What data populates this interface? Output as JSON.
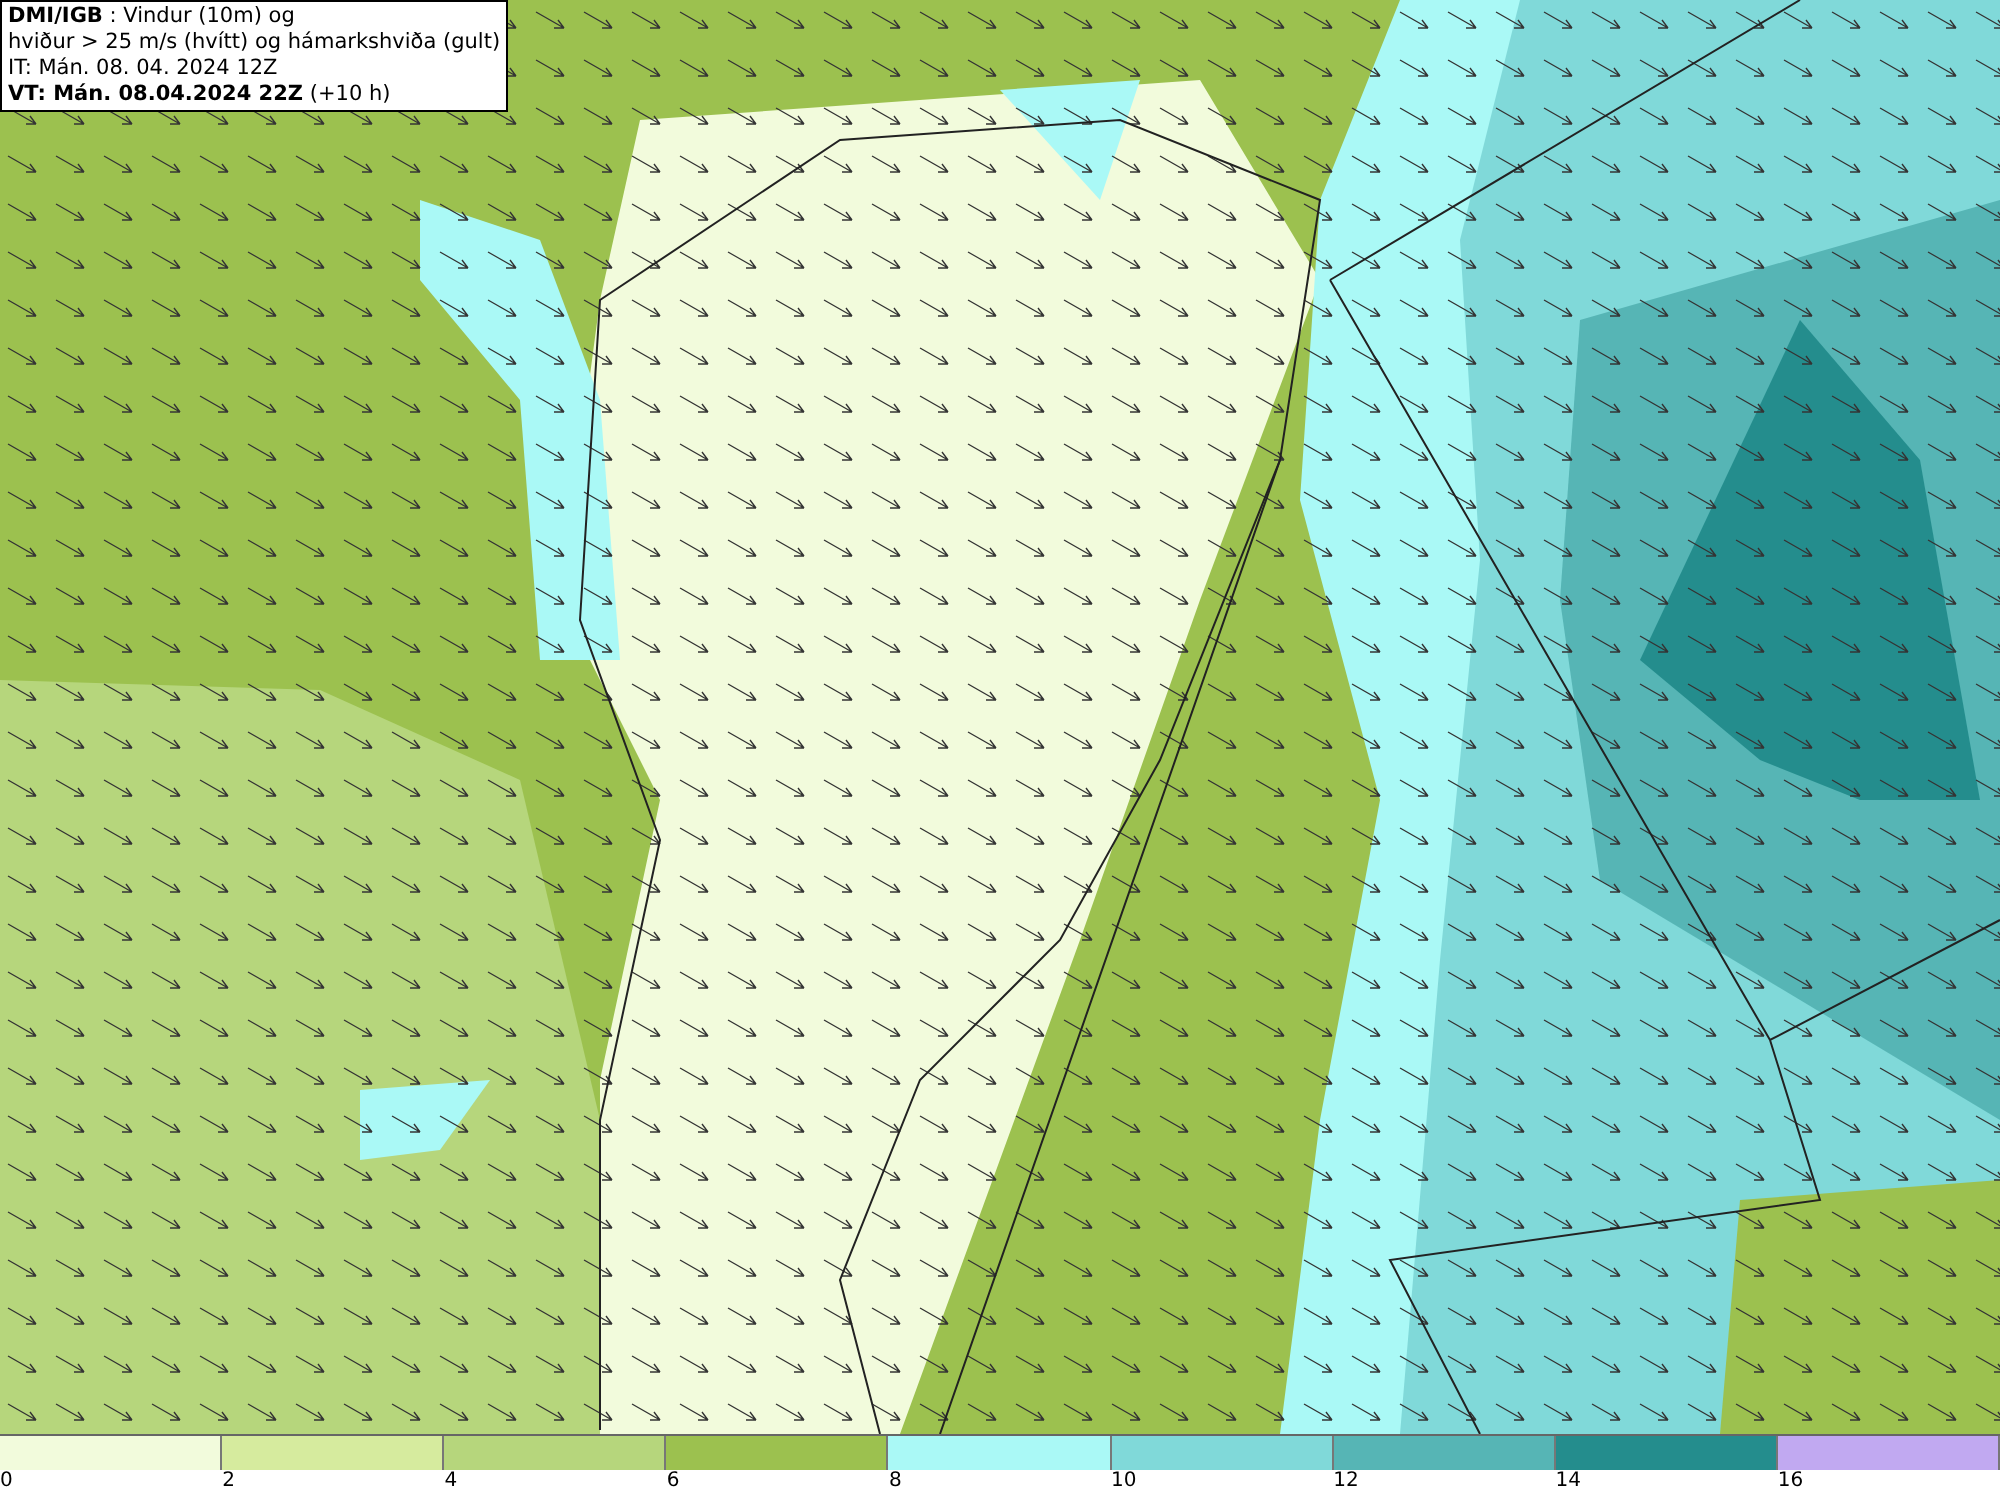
{
  "legend": {
    "lines": [
      "**DMI/IGB** : Vindur (10m) og",
      "hviður > 25 m/s (hvítt) og hámarkshviða (gult)",
      "IT: Mán. 08. 04. 2024 12Z",
      "**VT: Mán. 08.04.2024 22Z** (+10 h)"
    ]
  },
  "colorbar": [
    {
      "label": "0",
      "color": "#f2fbdc"
    },
    {
      "label": "2",
      "color": "#d6eb9e"
    },
    {
      "label": "4",
      "color": "#b6d67c"
    },
    {
      "label": "6",
      "color": "#9cc14f"
    },
    {
      "label": "8",
      "color": "#aaf9f6"
    },
    {
      "label": "10",
      "color": "#80d9d9"
    },
    {
      "label": "12",
      "color": "#56b5b5"
    },
    {
      "label": "14",
      "color": "#248d8d"
    },
    {
      "label": "16",
      "color": "#c1a9f1"
    }
  ]
}
